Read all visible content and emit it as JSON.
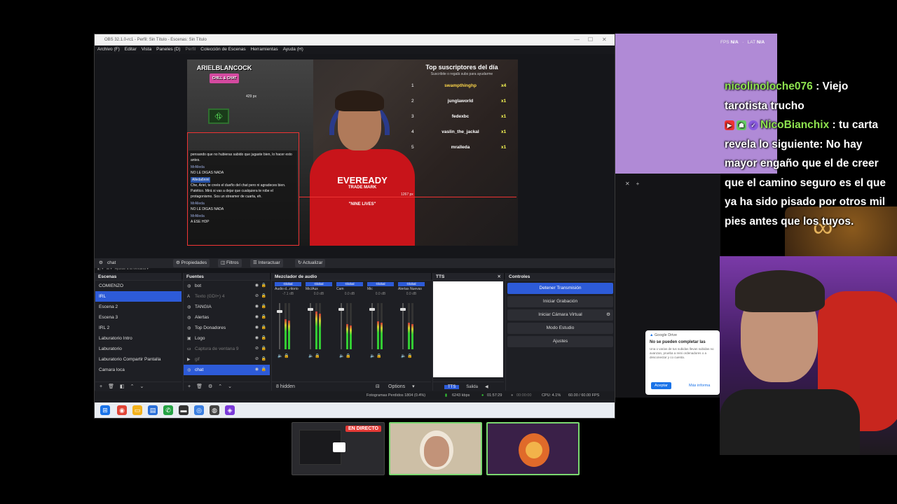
{
  "obs": {
    "title": "OBS 32.1.0-rc1 - Perfil: Sin Título - Escenas: Sin Título",
    "menu": [
      "Archivo (F)",
      "Editar",
      "Vista",
      "Paneles (D)",
      "Perfil",
      "Colección de Escenas",
      "Herramientas",
      "Ayuda (H)"
    ],
    "menu_disabled_index": 4,
    "preview": {
      "brand": "ARIELBLANCOCK",
      "brand_sub": "CHILL & CHAT",
      "measure_top": "429 px",
      "measure_right": "1267 px",
      "zoom_label": "Ajustar a la ventana",
      "chat_lines": [
        {
          "text": "pensando que no hubieras sabido que jugaste bien, lo hacer esto antes."
        },
        {
          "user": "MrAlleda",
          "text": "NO LE DIGAS NADA"
        },
        {
          "user_badge": "Alleda6ninl",
          "text": "Che, Ariel, te creés el dueño del chat pero ni agradeces bien. Patético. Mirá si vas a dejar que cualquiera te robe el protagonismo. Sos un streamer de cuarta, eh."
        },
        {
          "user": "MrAlleda",
          "text": "NO LE DIGAS NADA"
        },
        {
          "user": "MrAlleda",
          "text": "A ESE HDP"
        }
      ],
      "shirt_text": "EVEREADY",
      "shirt_sub": "TRADE MARK",
      "shirt_bottom": "\"NINE LIVES\"",
      "subs": {
        "title": "Top suscriptores del día",
        "subtitle": "Suscribite o regalá subs para ayudarme",
        "rows": [
          {
            "rank": "1",
            "name": "swampthinghp",
            "count": "x4"
          },
          {
            "rank": "2",
            "name": "junglaworld",
            "count": "x1"
          },
          {
            "rank": "3",
            "name": "fedexbc",
            "count": "x1"
          },
          {
            "rank": "4",
            "name": "vaslin_the_jackal",
            "count": "x1"
          },
          {
            "rank": "5",
            "name": "mralleda",
            "count": "x1"
          }
        ]
      }
    },
    "toolbar": {
      "current_source": "chat",
      "properties": "Propiedades",
      "filters": "Filtros",
      "interact": "Interactuar",
      "refresh": "Actualizar"
    },
    "scenes": {
      "header": "Escenas",
      "items": [
        "COMIENZO",
        "IRL",
        "Escena 2",
        "Escena 3",
        "IRL 2",
        "Laburatorio Intro",
        "Laburatorio",
        "Laburatorio Compartir Pantalla",
        "Camara loca"
      ],
      "selected": 1
    },
    "sources": {
      "header": "Fuentes",
      "items": [
        {
          "name": "bot",
          "icon": "globe-icon",
          "dim": false
        },
        {
          "name": "Texto (GDI+) 4",
          "icon": "text-icon",
          "dim": true
        },
        {
          "name": "TANGIA",
          "icon": "globe-icon",
          "dim": false
        },
        {
          "name": "Alertas",
          "icon": "globe-icon",
          "dim": false
        },
        {
          "name": "Top Donadores",
          "icon": "globe-icon",
          "dim": false
        },
        {
          "name": "Logo",
          "icon": "image-icon",
          "dim": false
        },
        {
          "name": "Captura de ventana 9",
          "icon": "window-icon",
          "dim": true
        },
        {
          "name": "gif",
          "icon": "media-icon",
          "dim": true
        },
        {
          "name": "chat",
          "icon": "globe-icon",
          "dim": false
        }
      ],
      "selected": 8
    },
    "mixer": {
      "header": "Mezclador de audio",
      "hidden_label": "8 hidden",
      "options_label": "Options",
      "channels": [
        {
          "hdr": "Global",
          "name": "Audio d...ritorio",
          "db": "-7.1 dB",
          "level": 0.65,
          "fader": 0.85
        },
        {
          "hdr": "Global",
          "name": "Mic/Aux",
          "db": "0.0 dB",
          "level": 0.82,
          "fader": 0.9
        },
        {
          "hdr": "Global",
          "name": "Cam",
          "db": "0.0 dB",
          "level": 0.55,
          "fader": 0.9
        },
        {
          "hdr": "Global",
          "name": "Mic",
          "db": "0.0 dB",
          "level": 0.6,
          "fader": 0.9
        },
        {
          "hdr": "Global",
          "name": "Alertas Nuevas",
          "db": "0.0 dB",
          "level": 0.58,
          "fader": 0.9
        }
      ]
    },
    "tts": {
      "header": "TTS",
      "tab_active": "TTS",
      "tab_other": "Salida"
    },
    "controls": {
      "header": "Controles",
      "buttons": [
        "Detener Transmisión",
        "Iniciar Grabación",
        "Iniciar Cámara Virtual",
        "Modo Estudio",
        "Ajustes"
      ]
    },
    "status": {
      "dropped": "Fotogramas Perdidos 1804 (0.4%)",
      "bitrate": "6243 kbps",
      "live_time": "01:57:29",
      "rec_time": "00:00:00",
      "cpu": "CPU: 4.1%",
      "fps": "60.00 / 60.00 FPS"
    }
  },
  "overlay": {
    "fps_label": "FPS",
    "fps_value": "N/A",
    "lat_label": "LAT",
    "lat_value": "N/A"
  },
  "chat": [
    {
      "user": "nicolinoloche076",
      "text": ": Viejo tarotista trucho"
    },
    {
      "user": "NicoBianchix",
      "text": ": tu carta revela lo siguiente: No hay mayor engaño que el de creer que el camino seguro es el que ya ha sido pisado por otros mil pies antes que los tuyos."
    }
  ],
  "gdrive": {
    "app": "Google Drive",
    "title": "No se pueden completar las",
    "body": "Una o varias de tus subidas llevan subidas no avanzan, prueba a reini ordenadores o a desconectar y co cuenta.",
    "accept": "Aceptar",
    "more": "Más informa"
  },
  "thumbnails": {
    "live_badge": "EN DIRECTO"
  }
}
